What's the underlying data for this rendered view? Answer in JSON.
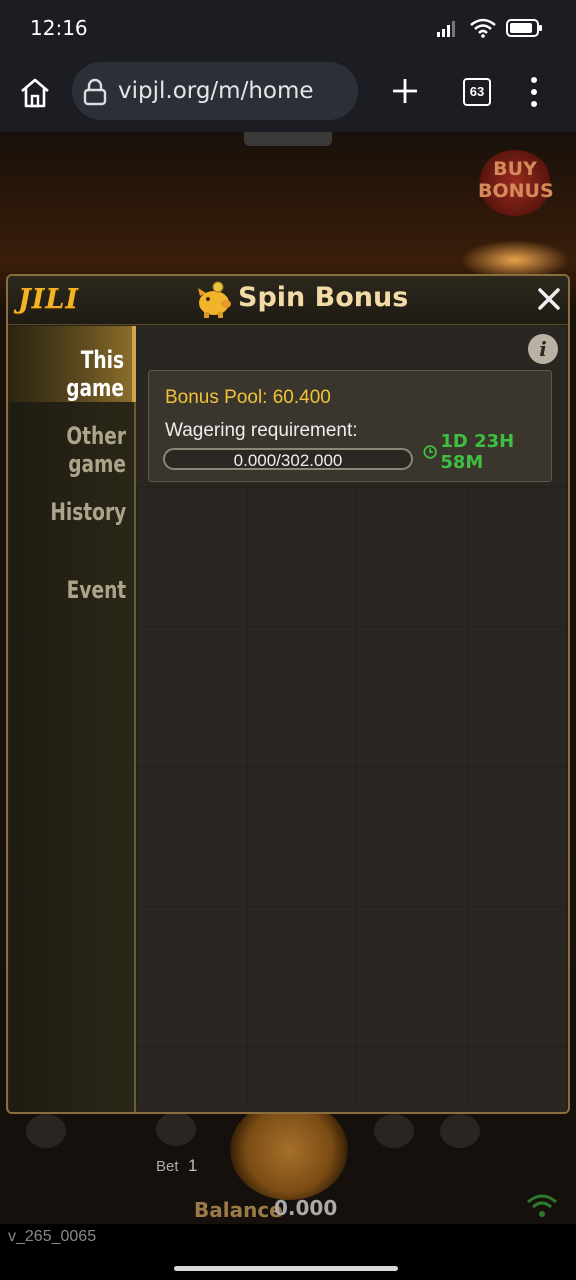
{
  "status_bar": {
    "time": "12:16"
  },
  "browser": {
    "url": "vipjl.org/m/home",
    "tab_count": "63"
  },
  "game": {
    "buy_bonus_line1": "BUY",
    "buy_bonus_line2": "BONUS",
    "bet_label": "Bet",
    "bet_value": "1",
    "balance_label": "Balance",
    "balance_value": "0.000",
    "version": "v_265_0065"
  },
  "modal": {
    "brand": "JILI",
    "title": "Spin Bonus",
    "sidebar": [
      {
        "label": "This game",
        "active": true
      },
      {
        "label": "Other game",
        "active": false
      },
      {
        "label": "History",
        "active": false
      },
      {
        "label": "Event",
        "active": false
      }
    ],
    "bonus_pool": "Bonus Pool: 60.400",
    "wagering_label": "Wagering requirement:",
    "wagering_progress": "0.000/302.000",
    "wagering_fraction": 0.0,
    "timer": "1D 23H 58M"
  },
  "colors": {
    "accent_gold": "#f4b425",
    "timer_green": "#3fbf3f"
  }
}
